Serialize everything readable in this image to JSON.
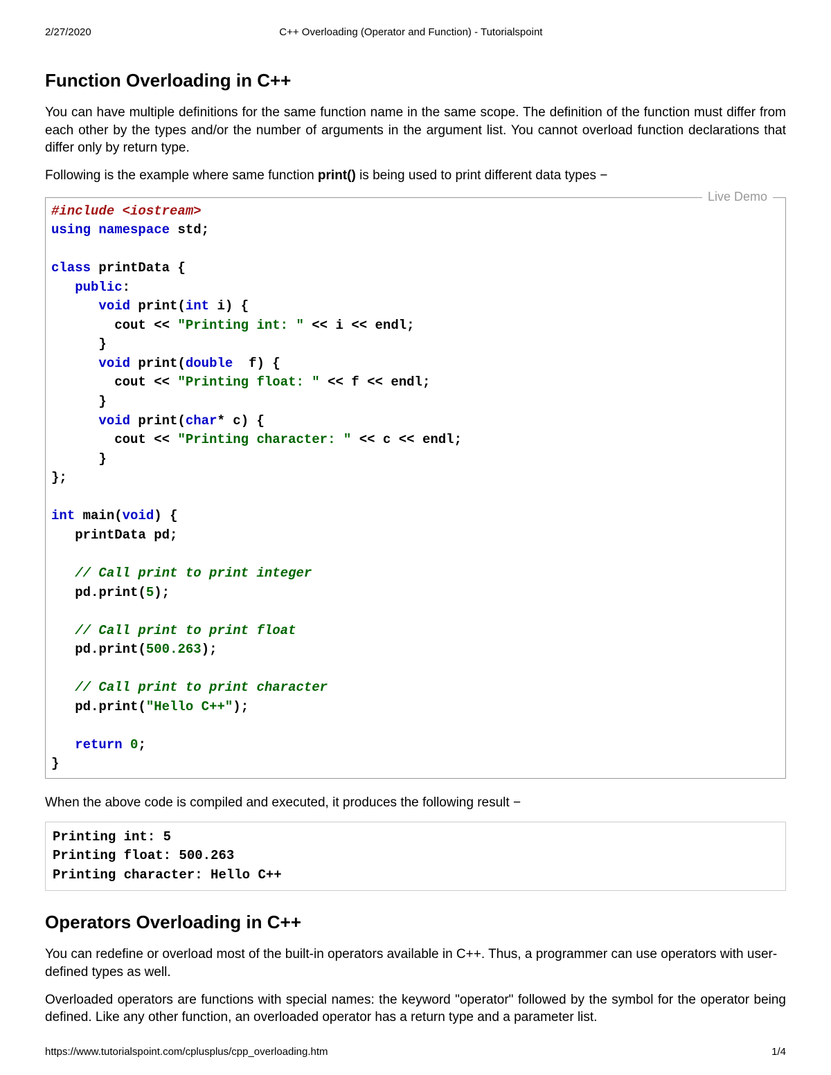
{
  "header": {
    "date": "2/27/2020",
    "pageTitle": "C++ Overloading (Operator and Function) - Tutorialspoint"
  },
  "footer": {
    "url": "https://www.tutorialspoint.com/cplusplus/cpp_overloading.htm",
    "page": "1/4"
  },
  "section1": {
    "heading": "Function Overloading in C++",
    "p1": "You can have multiple definitions for the same function name in the same scope. The definition of the function must differ from each other by the types and/or the number of arguments in the argument list. You cannot overload function declarations that differ only by return type.",
    "p2_pre": "Following is the example where same function ",
    "p2_bold": "print()",
    "p2_post": " is being used to print different data types −"
  },
  "codeBlock": {
    "liveDemoLabel": "Live Demo",
    "tokens": {
      "include": "#include",
      "iostream": " <iostream>",
      "using": "using",
      "namespace": " namespace",
      "std": " std",
      "semi": ";",
      "class": "class",
      "printData": " printData ",
      "lbrace": "{",
      "rbrace": "}",
      "publicKw": "public",
      "colon": ":",
      "voidKw": "void",
      "printFn": " print",
      "lparen": "(",
      "rparen": ")",
      "intKw": "int",
      "iVar": " i",
      "space": " ",
      "cout": "cout ",
      "lshift": "<<",
      "strInt": " \"Printing int: \" ",
      "iRef": " i ",
      "endl": " endl",
      "doubleKw": "double",
      "fVar": "  f",
      "strFloat": " \"Printing float: \" ",
      "fRef": " f ",
      "charKw": "char",
      "star": "*",
      "cVar": " c",
      "strChar": " \"Printing character: \" ",
      "cRef": " c ",
      "classEnd": "};",
      "mainFn": " main",
      "pdDecl": "   printData pd",
      "comInt": "// Call print to print integer",
      "pdCall": "pd",
      "dot": ".",
      "printCall": "print",
      "five": "5",
      "comFloat": "// Call print to print float",
      "floatNum": "500.263",
      "comChar": "// Call print to print character",
      "helloStr": "\"Hello C++\"",
      "returnKw": "return",
      "zero": " 0"
    }
  },
  "afterCode": {
    "p": "When the above code is compiled and executed, it produces the following result −"
  },
  "output": {
    "text": "Printing int: 5\nPrinting float: 500.263\nPrinting character: Hello C++"
  },
  "section2": {
    "heading": "Operators Overloading in C++",
    "p1": "You can redefine or overload most of the built-in operators available in C++. Thus, a programmer can use operators with user-defined types as well.",
    "p2": "Overloaded operators are functions with special names: the keyword \"operator\" followed by the symbol for the operator being defined. Like any other function, an overloaded operator has a return type and a parameter list."
  }
}
